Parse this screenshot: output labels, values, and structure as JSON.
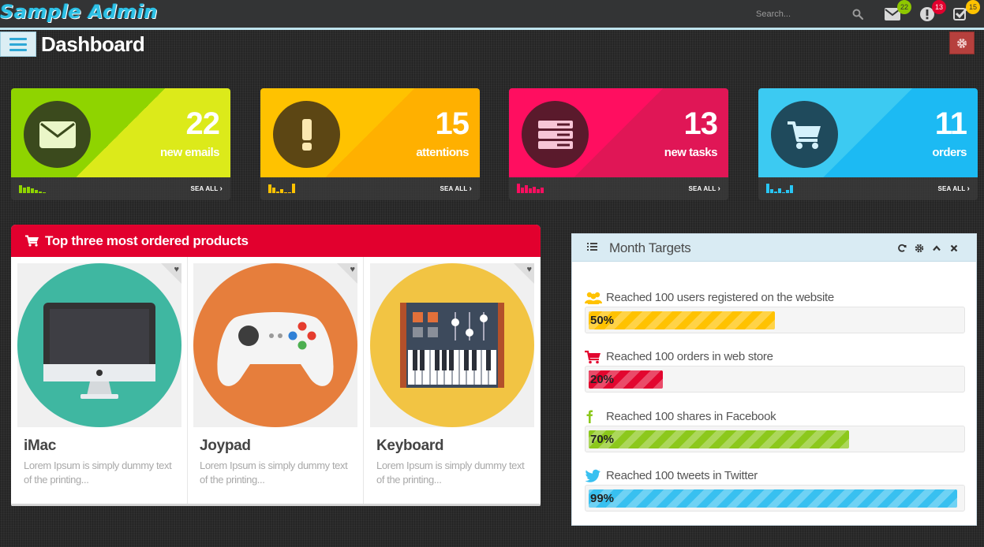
{
  "topbar": {
    "brand": "Sample Admin",
    "search_placeholder": "Search...",
    "badges": {
      "messages": "22",
      "alerts": "13",
      "tasks": "15"
    }
  },
  "header": {
    "title": "Dashboard"
  },
  "tiles": [
    {
      "number": "22",
      "label": "new emails",
      "link": "SEA ALL",
      "icon": "envelope-icon",
      "color": "#8fd400",
      "spark": [
        8,
        6,
        7,
        5,
        3,
        2,
        1
      ]
    },
    {
      "number": "15",
      "label": "attentions",
      "link": "SEA ALL",
      "icon": "exclamation-icon",
      "color": "#ffc200",
      "spark": [
        9,
        6,
        2,
        4,
        1,
        1,
        10
      ]
    },
    {
      "number": "13",
      "label": "new tasks",
      "link": "SEA ALL",
      "icon": "server-icon",
      "color": "#ff0e60",
      "spark": [
        10,
        6,
        8,
        5,
        7,
        4,
        6
      ]
    },
    {
      "number": "11",
      "label": "orders",
      "link": "SEA ALL",
      "icon": "cart-icon",
      "color": "#28c6f5",
      "spark": [
        10,
        4,
        2,
        5,
        1,
        3,
        8
      ]
    }
  ],
  "products": {
    "title": "Top three most ordered products",
    "items": [
      {
        "name": "iMac",
        "description": "Lorem Ipsum is simply dummy text of the printing...",
        "icon": "monitor-icon",
        "color": "#3fb7a1"
      },
      {
        "name": "Joypad",
        "description": "Lorem Ipsum is simply dummy text of the printing...",
        "icon": "gamepad-icon",
        "color": "#e67e3c"
      },
      {
        "name": "Keyboard",
        "description": "Lorem Ipsum is simply dummy text of the printing...",
        "icon": "piano-keyboard-icon",
        "color": "#f2c443"
      }
    ]
  },
  "targets": {
    "title": "Month Targets",
    "items": [
      {
        "label": "Reached 100 users registered on the website",
        "percent_text": "50%",
        "value": 50,
        "color": "#ffc200",
        "icon": "users-icon"
      },
      {
        "label": "Reached 100 orders in web store",
        "percent_text": "20%",
        "value": 20,
        "color": "#e2062f",
        "icon": "cart-icon"
      },
      {
        "label": "Reached 100 shares in Facebook",
        "percent_text": "70%",
        "value": 70,
        "color": "#8cc81c",
        "icon": "facebook-icon"
      },
      {
        "label": "Reached 100 tweets in Twitter",
        "percent_text": "99%",
        "value": 99,
        "color": "#38c0f0",
        "icon": "twitter-icon"
      }
    ]
  }
}
